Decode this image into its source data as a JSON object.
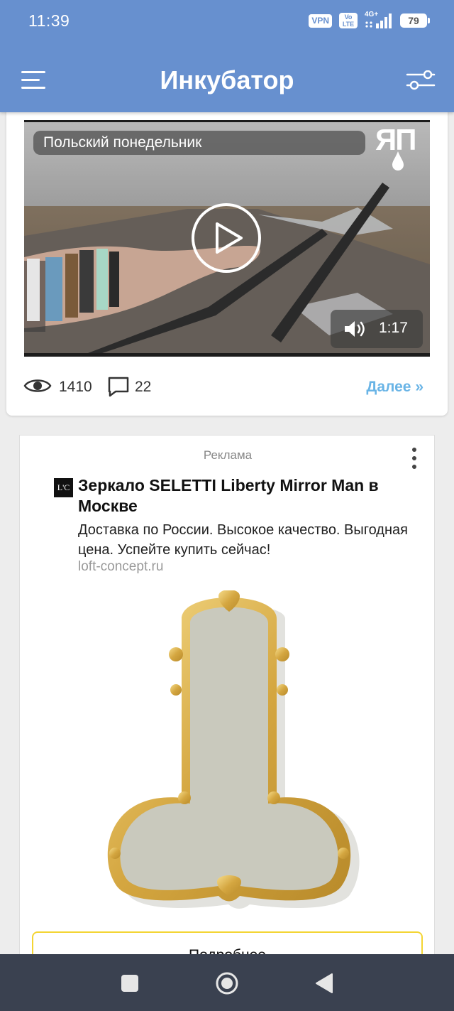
{
  "status_bar": {
    "time": "11:39",
    "vpn": "VPN",
    "volte_top": "Vo",
    "volte_bottom": "LTE",
    "network": "4G+",
    "battery": "79"
  },
  "header": {
    "title": "Инкубатор",
    "menu_icon": "hamburger-menu-icon",
    "filter_icon": "sliders-filter-icon",
    "background_color": "#6790cf"
  },
  "post": {
    "video": {
      "title": "Польский понедельник",
      "logo_text": "ЯП",
      "duration": "1:17"
    },
    "views": "1410",
    "comments": "22",
    "more_link": "Далее »",
    "accent_color": "#69b4e6"
  },
  "ad": {
    "label": "Реклама",
    "favicon_text": "L'C",
    "title": "Зеркало SELETTI Liberty Mirror Man в Москве",
    "description": "Доставка по России. Высокое качество. Выгодная цена. Успейте купить сейчас!",
    "domain": "loft-concept.ru",
    "button_label": "Подробнее",
    "button_border_color": "#f4d533"
  },
  "nav_bar": {
    "recents_icon": "square-recents-icon",
    "home_icon": "circle-home-icon",
    "back_icon": "triangle-back-icon"
  }
}
